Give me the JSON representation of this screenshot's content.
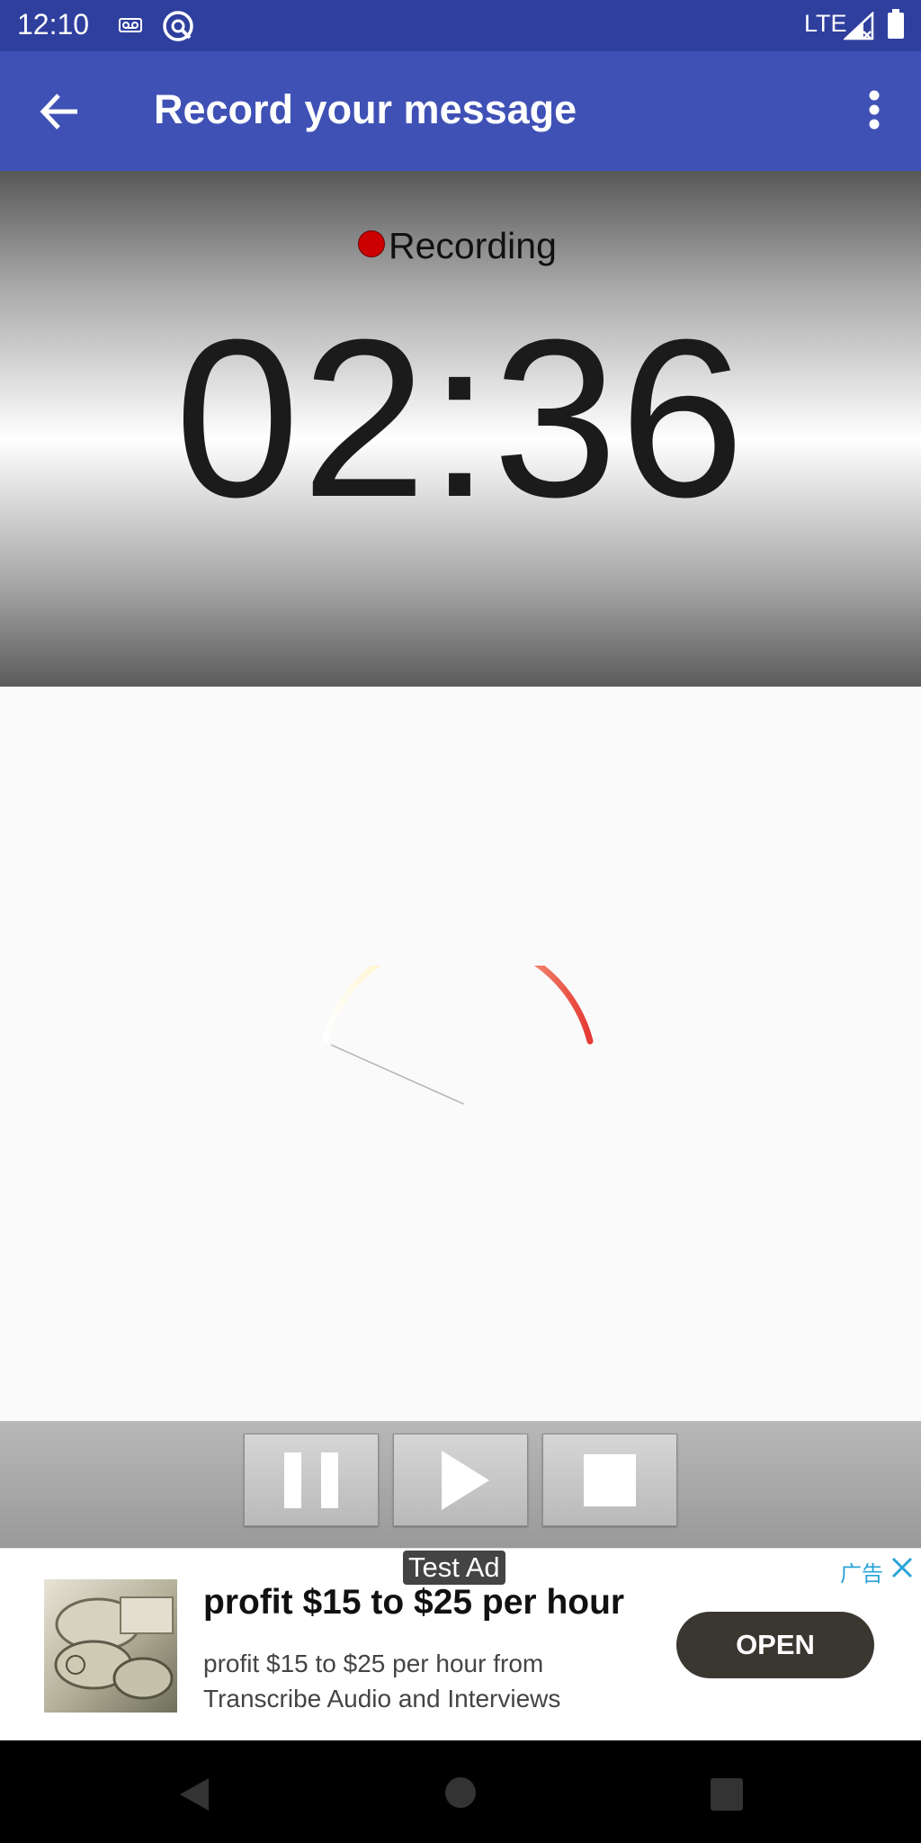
{
  "status_bar": {
    "time": "12:10",
    "network": "LTE",
    "icons": [
      "voicemail-icon",
      "assistant-icon",
      "signal-icon",
      "battery-icon"
    ]
  },
  "app_bar": {
    "title": "Record your message",
    "back_icon": "arrow-left-icon",
    "menu_icon": "more-vert-icon"
  },
  "recorder": {
    "status_label": "Recording",
    "elapsed": "02:36",
    "indicator_color": "#cc0000"
  },
  "controls": {
    "buttons": [
      {
        "name": "pause",
        "icon": "pause-icon"
      },
      {
        "name": "play",
        "icon": "play-icon"
      },
      {
        "name": "stop",
        "icon": "stop-icon"
      }
    ]
  },
  "ad": {
    "tag": "Test Ad",
    "choices_label": "广告",
    "headline": "profit $15 to $25 per hour",
    "body": "profit $15 to $25 per hour from Transcribe Audio and Interviews",
    "cta": "OPEN"
  },
  "colors": {
    "status_bar": "#2f3f9e",
    "app_bar": "#3f51b5",
    "gauge_start": "#fff3c4",
    "gauge_end": "#e53935",
    "ad_link": "#2aa3d8",
    "ad_button": "#3a3630"
  }
}
